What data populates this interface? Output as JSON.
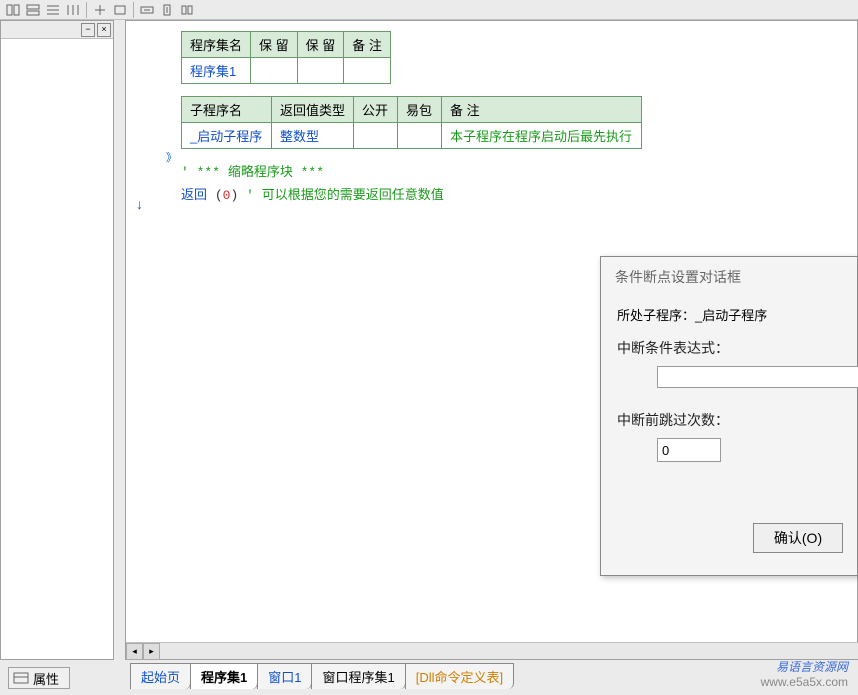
{
  "colors": {
    "link": "#1050cc",
    "green": "#1a9a1a",
    "table_border": "#6a9a6a"
  },
  "table1": {
    "headers": [
      "程序集名",
      "保 留",
      "保 留",
      "备 注"
    ],
    "row": [
      "程序集1",
      "",
      "",
      ""
    ]
  },
  "table2": {
    "headers": [
      "子程序名",
      "返回值类型",
      "公开",
      "易包",
      "备  注"
    ],
    "row": {
      "name": "_启动子程序",
      "ret_type": "整数型",
      "public": "",
      "yibao": "",
      "remark": "本子程序在程序启动后最先执行"
    }
  },
  "code": {
    "collapsed_prefix": "'",
    "collapsed": "*** 缩略程序块 ***",
    "return_kw": "返回",
    "return_val": "0",
    "return_comment_prefix": "'",
    "return_comment": "可以根据您的需要返回任意数值"
  },
  "dialog": {
    "title": "条件断点设置对话框",
    "sub_label": "所处子程序：",
    "sub_value": "_启动子程序",
    "cond_label": "中断条件表达式：",
    "cond_value": "",
    "skip_label": "中断前跳过次数：",
    "skip_value": "0",
    "ok_button": "确认(O)"
  },
  "tabs": {
    "start": "起始页",
    "progset1": "程序集1",
    "window1": "窗口1",
    "winprogset1": "窗口程序集1",
    "dlltable": "[Dll命令定义表]"
  },
  "prop_tab": "属性",
  "watermark": {
    "line1": "易语言资源网",
    "line2": "www.e5a5x.com"
  }
}
